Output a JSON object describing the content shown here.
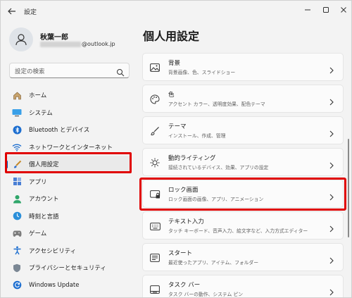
{
  "window": {
    "title": "設定"
  },
  "user": {
    "name": "秋葉一郎",
    "email_visible_suffix": "@outlook.jp"
  },
  "search": {
    "placeholder": "設定の検索"
  },
  "nav": [
    {
      "label": "ホーム",
      "icon": "home-icon"
    },
    {
      "label": "システム",
      "icon": "monitor-icon"
    },
    {
      "label": "Bluetooth とデバイス",
      "icon": "bluetooth-icon"
    },
    {
      "label": "ネットワークとインターネット",
      "icon": "wifi-icon"
    },
    {
      "label": "個人用設定",
      "icon": "paintbrush-icon",
      "selected": true
    },
    {
      "label": "アプリ",
      "icon": "apps-icon"
    },
    {
      "label": "アカウント",
      "icon": "account-icon"
    },
    {
      "label": "時刻と言語",
      "icon": "globe-clock-icon"
    },
    {
      "label": "ゲーム",
      "icon": "gamepad-icon"
    },
    {
      "label": "アクセシビリティ",
      "icon": "accessibility-icon"
    },
    {
      "label": "プライバシーとセキュリティ",
      "icon": "shield-icon"
    },
    {
      "label": "Windows Update",
      "icon": "update-icon"
    }
  ],
  "main": {
    "title": "個人用設定",
    "cards": [
      {
        "title": "背景",
        "subtitle": "背景画像、色、スライドショー",
        "icon": "picture-icon"
      },
      {
        "title": "色",
        "subtitle": "アクセント カラー、透明度効果、配色テーマ",
        "icon": "palette-icon"
      },
      {
        "title": "テーマ",
        "subtitle": "インストール、作成、管理",
        "icon": "brush-icon"
      },
      {
        "title": "動的ライティング",
        "subtitle": "接続されているデバイス、効果、アプリの設定",
        "icon": "sun-icon"
      },
      {
        "title": "ロック画面",
        "subtitle": "ロック画面の画像、アプリ、アニメーション",
        "icon": "lock-screen-icon"
      },
      {
        "title": "テキスト入力",
        "subtitle": "タッチ キーボード、音声入力、絵文字など、入力方式エディター",
        "icon": "keyboard-icon"
      },
      {
        "title": "スタート",
        "subtitle": "最近使ったアプリ、アイテム、フォルダー",
        "icon": "start-icon"
      },
      {
        "title": "タスク バー",
        "subtitle": "タスク バーの動作、システム ピン",
        "icon": "taskbar-icon"
      }
    ]
  },
  "colors": {
    "accent": "#005fb8",
    "highlight": "#e00000",
    "background": "#f3f3f3",
    "card": "#fbfbfb"
  }
}
